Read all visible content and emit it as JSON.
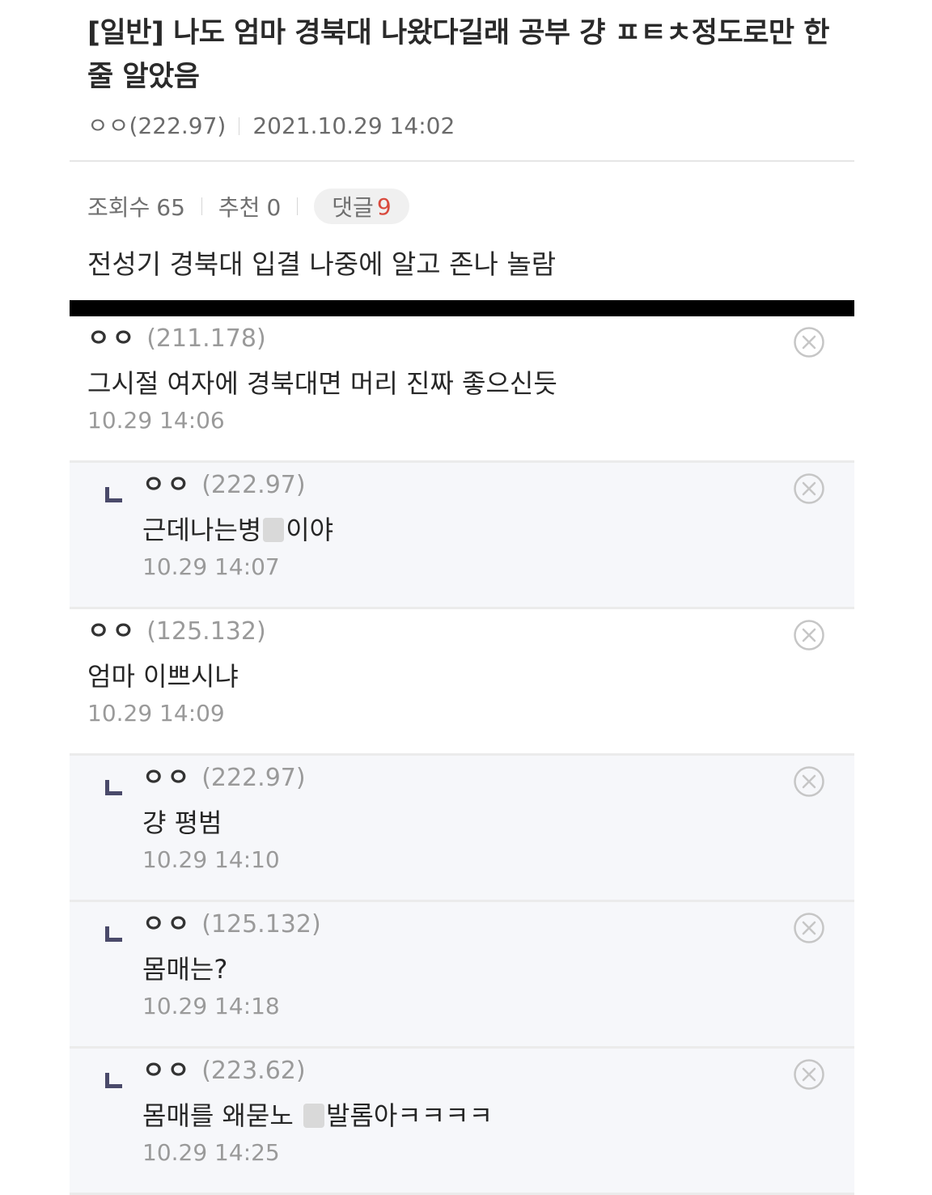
{
  "post": {
    "title": "[일반] 나도 엄마 경북대 나왔다길래 공부 걍 ㅍㅌㅊ정도로만 한 줄 알았음",
    "author": "ㅇㅇ(222.97)",
    "datetime": "2021.10.29 14:02",
    "views_label": "조회수",
    "views": "65",
    "recommend_label": "추천",
    "recommend": "0",
    "comments_label": "댓글",
    "comments_count": "9",
    "body": "전성기 경북대 입결 나중에 알고 존나 놀람"
  },
  "comments": [
    {
      "reply": false,
      "name": "ㅇㅇ",
      "ip": "(211.178)",
      "text": "그시절 여자에 경북대면 머리 진짜 좋으신듯",
      "date": "10.29 14:06"
    },
    {
      "reply": true,
      "name": "ㅇㅇ",
      "ip": "(222.97)",
      "text_before": "근데나는병",
      "text_after": "이야",
      "censored": true,
      "date": "10.29 14:07"
    },
    {
      "reply": false,
      "name": "ㅇㅇ",
      "ip": "(125.132)",
      "text": "엄마 이쁘시냐",
      "date": "10.29 14:09"
    },
    {
      "reply": true,
      "name": "ㅇㅇ",
      "ip": "(222.97)",
      "text": "걍 평범",
      "date": "10.29 14:10"
    },
    {
      "reply": true,
      "name": "ㅇㅇ",
      "ip": "(125.132)",
      "text": "몸매는?",
      "date": "10.29 14:18"
    },
    {
      "reply": true,
      "name": "ㅇㅇ",
      "ip": "(223.62)",
      "text_before": "몸매를 왜묻노 ",
      "text_after": "발롬아ㅋㅋㅋㅋ",
      "censored": true,
      "date": "10.29 14:25"
    }
  ],
  "colors": {
    "comment_count_accent": "#d94a3d",
    "reply_background": "#f6f7fa",
    "divider": "#000000"
  },
  "icons": {
    "reply": "reply-arrow-icon",
    "delete": "close-circle-icon"
  }
}
